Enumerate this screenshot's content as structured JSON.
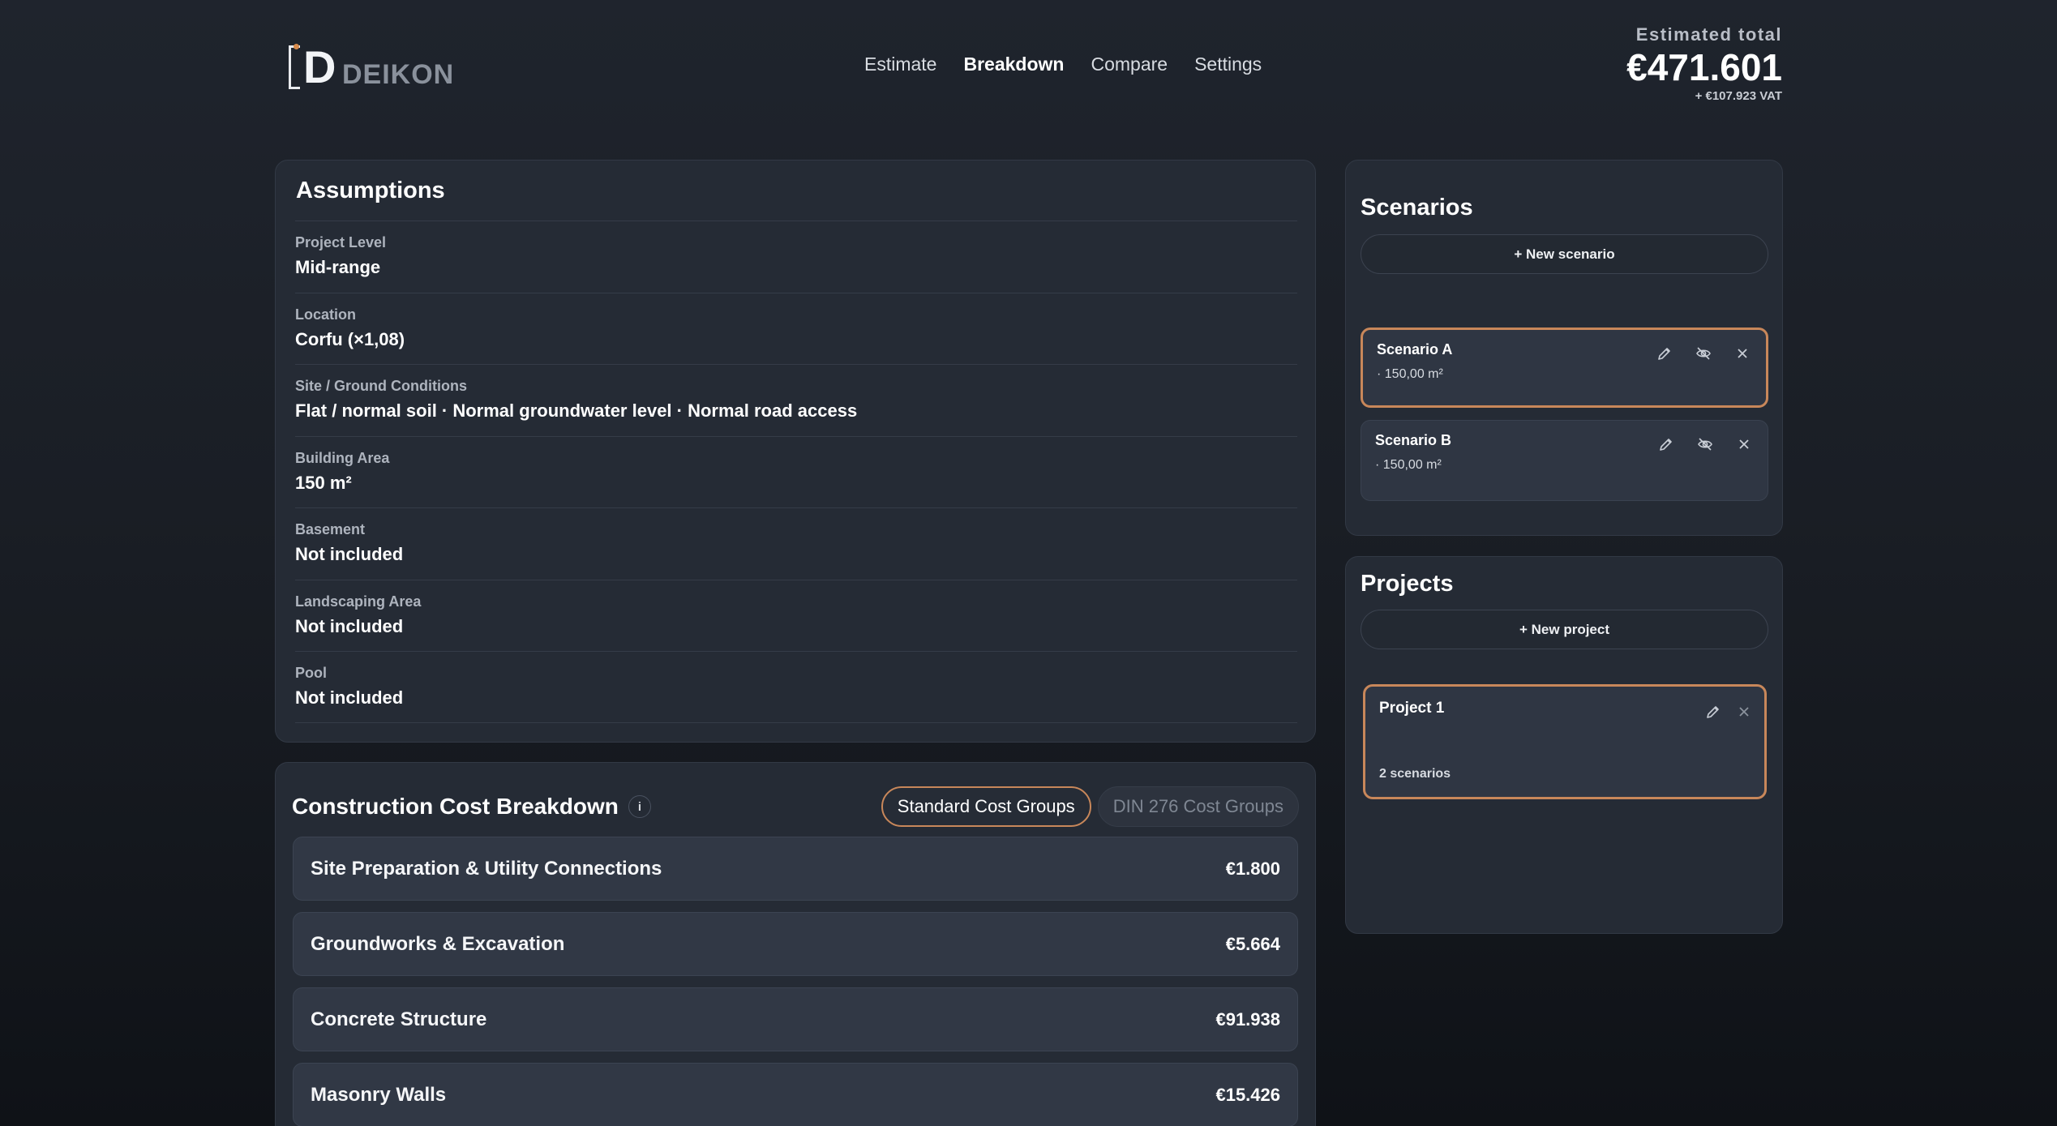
{
  "brand": {
    "letter": "D",
    "name": "DEIKON"
  },
  "nav": {
    "items": [
      {
        "label": "Estimate"
      },
      {
        "label": "Breakdown",
        "active": true
      },
      {
        "label": "Compare"
      },
      {
        "label": "Settings"
      }
    ]
  },
  "total": {
    "label": "Estimated total",
    "value": "€471.601",
    "vat": "+ €107.923 VAT"
  },
  "assumptions": {
    "title": "Assumptions",
    "rows": [
      {
        "label": "Project Level",
        "value": "Mid-range"
      },
      {
        "label": "Location",
        "value": "Corfu (×1,08)"
      },
      {
        "label": "Site / Ground Conditions",
        "value": "Flat / normal soil · Normal groundwater level · Normal road access"
      },
      {
        "label": "Building Area",
        "value": "150 m²"
      },
      {
        "label": "Basement",
        "value": "Not included"
      },
      {
        "label": "Landscaping Area",
        "value": "Not included"
      },
      {
        "label": "Pool",
        "value": "Not included"
      }
    ]
  },
  "breakdown": {
    "title": "Construction Cost Breakdown",
    "info": "i",
    "toggle": {
      "standard": "Standard Cost Groups",
      "din": "DIN 276 Cost Groups",
      "selected": "standard"
    },
    "rows": [
      {
        "name": "Site Preparation & Utility Connections",
        "value": "€1.800"
      },
      {
        "name": "Groundworks & Excavation",
        "value": "€5.664"
      },
      {
        "name": "Concrete Structure",
        "value": "€91.938"
      },
      {
        "name": "Masonry Walls",
        "value": "€15.426"
      }
    ]
  },
  "scenarios": {
    "title": "Scenarios",
    "new_label": "+ New scenario",
    "items": [
      {
        "name": "Scenario A",
        "sub": "· 150,00 m²",
        "selected": true
      },
      {
        "name": "Scenario B",
        "sub": "· 150,00 m²",
        "selected": false
      }
    ]
  },
  "projects": {
    "title": "Projects",
    "new_label": "+ New project",
    "items": [
      {
        "name": "Project 1",
        "sub": "2 scenarios",
        "selected": true
      }
    ]
  },
  "colors": {
    "accent": "#c8875a",
    "background": "#1a1e25",
    "card": "#252b35"
  },
  "icons": [
    "pencil-icon",
    "eye-off-icon",
    "close-icon",
    "info-icon"
  ]
}
